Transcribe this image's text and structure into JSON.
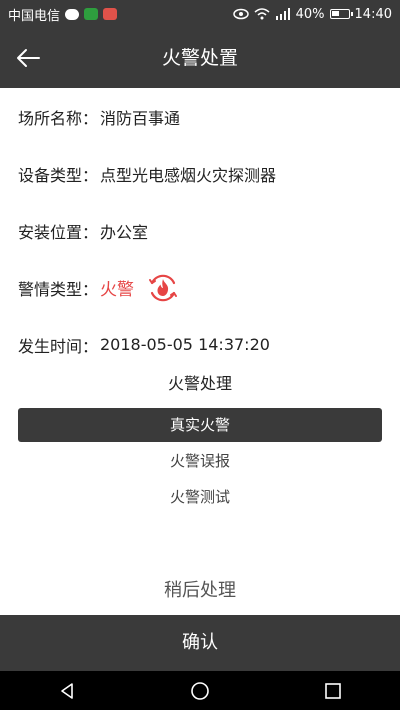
{
  "status_bar": {
    "carrier": "中国电信",
    "battery": "40%",
    "time": "14:40"
  },
  "header": {
    "title": "火警处置",
    "back_icon": "arrow-left-icon"
  },
  "info": {
    "place": {
      "label": "场所名称：",
      "value": "消防百事通"
    },
    "device_type": {
      "label": "设备类型：",
      "value": "点型光电感烟火灾探测器"
    },
    "location": {
      "label": "安装位置：",
      "value": "办公室"
    },
    "alarm_type": {
      "label": "警情类型：",
      "value": "火警",
      "icon": "fire-alarm-icon",
      "color": "#e64545"
    },
    "time": {
      "label": "发生时间：",
      "value": "2018-05-05 14:37:20"
    }
  },
  "handling": {
    "title": "火警处理",
    "options": [
      "真实火警",
      "火警误报",
      "火警测试"
    ],
    "selected": "真实火警"
  },
  "later_label": "稍后处理",
  "confirm_label": "确认",
  "colors": {
    "bar_bg": "#3a3a3a",
    "alarm": "#e64545"
  }
}
